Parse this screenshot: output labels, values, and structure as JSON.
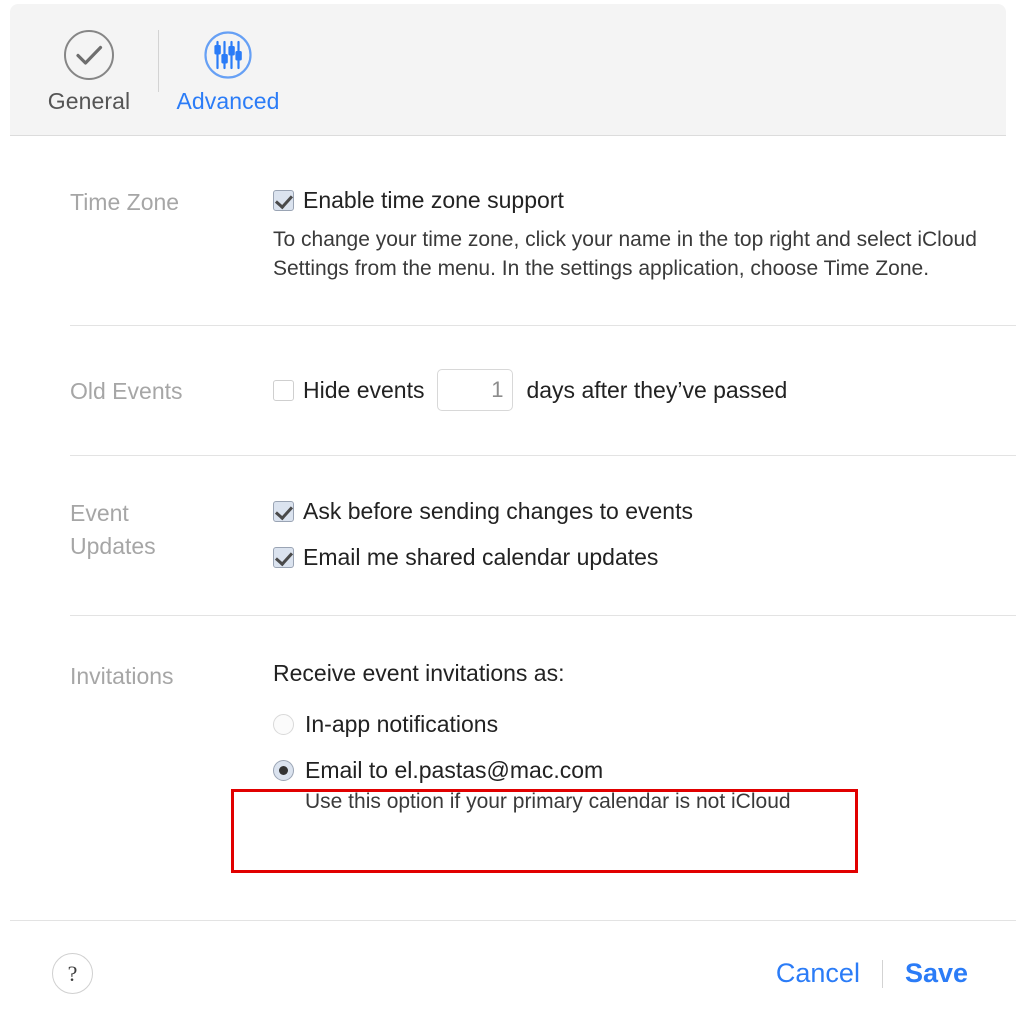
{
  "window": {
    "title": "Calendar Settings"
  },
  "colors": {
    "accent": "#2b7cf7",
    "highlight": "#e10000",
    "label": "#a6a6a6",
    "toolbar_bg": "#f4f4f4"
  },
  "toolbar": {
    "tabs": [
      {
        "id": "general",
        "label": "General",
        "icon": "check-circle-icon",
        "selected": false
      },
      {
        "id": "advanced",
        "label": "Advanced",
        "icon": "sliders-circle-icon",
        "selected": true
      }
    ]
  },
  "sections": {
    "time_zone": {
      "label": "Time Zone",
      "checkbox_label": "Enable time zone support",
      "checkbox_checked": true,
      "help_text": "To change your time zone, click your name in the top right and select iCloud Settings from the menu. In the settings application, choose Time Zone."
    },
    "old_events": {
      "label": "Old Events",
      "checkbox_label": "Hide events",
      "checkbox_checked": false,
      "days_value": "1",
      "days_placeholder": "1",
      "suffix_label": "days after they’ve passed"
    },
    "event_updates": {
      "label": "Event Updates",
      "options": [
        {
          "label": "Ask before sending changes to events",
          "checked": true
        },
        {
          "label": "Email me shared calendar updates",
          "checked": true
        }
      ]
    },
    "invitations": {
      "label": "Invitations",
      "heading": "Receive event invitations as:",
      "options": [
        {
          "label": "In-app notifications",
          "selected": false,
          "sub_text": ""
        },
        {
          "label": "Email to el.pastas@mac.com",
          "selected": true,
          "sub_text": "Use this option if your primary calendar is not iCloud"
        }
      ]
    }
  },
  "footer": {
    "help_label": "?",
    "cancel_label": "Cancel",
    "save_label": "Save"
  }
}
